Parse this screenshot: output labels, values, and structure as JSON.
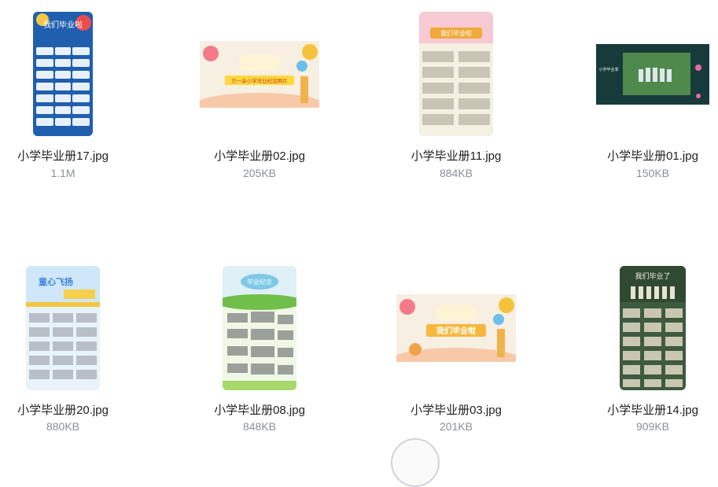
{
  "files": [
    {
      "name": "小学毕业册17.jpg",
      "size": "1.1M",
      "thumb_text": "我们毕业啦"
    },
    {
      "name": "小学毕业册02.jpg",
      "size": "205KB",
      "thumb_text": "方一朵小学毕业纪念照片"
    },
    {
      "name": "小学毕业册11.jpg",
      "size": "884KB",
      "thumb_text": "我们毕业啦"
    },
    {
      "name": "小学毕业册01.jpg",
      "size": "150KB",
      "thumb_text": "小学毕业季"
    },
    {
      "name": "小学毕业册20.jpg",
      "size": "880KB",
      "thumb_text": "童心飞扬"
    },
    {
      "name": "小学毕业册08.jpg",
      "size": "848KB",
      "thumb_text": "毕业纪念"
    },
    {
      "name": "小学毕业册03.jpg",
      "size": "201KB",
      "thumb_text": "我们毕业啦"
    },
    {
      "name": "小学毕业册14.jpg",
      "size": "909KB",
      "thumb_text": "我们毕业了"
    }
  ]
}
